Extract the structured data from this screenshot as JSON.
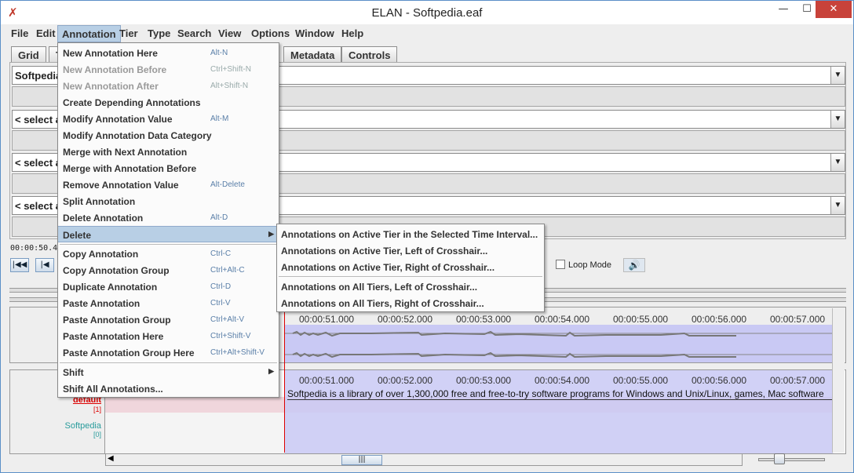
{
  "window": {
    "title": "ELAN - Softpedia.eaf",
    "minimize": "—",
    "maximize": "☐",
    "close": "✕"
  },
  "menubar": [
    "File",
    "Edit",
    "Annotation",
    "Tier",
    "Type",
    "Search",
    "View",
    "Options",
    "Window",
    "Help"
  ],
  "tabs": {
    "grid": "Grid",
    "t": "T",
    "metadata": "Metadata",
    "controls": "Controls"
  },
  "panel": {
    "combo1": "Softpedia",
    "combo2": "< select a",
    "combo3": "< select a",
    "combo4": "< select a"
  },
  "timecode": "00:00:50.461",
  "loop_mode": "Loop Mode",
  "ruler": [
    "00:00:51.000",
    "00:00:52.000",
    "00:00:53.000",
    "00:00:54.000",
    "00:00:55.000",
    "00:00:56.000",
    "00:00:57.000"
  ],
  "tiers": {
    "default": {
      "name": "default",
      "count": "[1]"
    },
    "softpedia": {
      "name": "Softpedia",
      "count": "[0]"
    }
  },
  "annotation_text": "Softpedia is a library of over 1,300,000 free and free-to-try software programs for Windows and Unix/Linux, games, Mac software",
  "annotation_menu": [
    {
      "label": "New Annotation Here",
      "acc": "Alt-N",
      "disabled": false
    },
    {
      "label": "New Annotation Before",
      "acc": "Ctrl+Shift-N",
      "disabled": true
    },
    {
      "label": "New Annotation After",
      "acc": "Alt+Shift-N",
      "disabled": true
    },
    {
      "label": "Create Depending Annotations",
      "acc": "",
      "disabled": false
    },
    {
      "label": "Modify Annotation Value",
      "acc": "Alt-M",
      "disabled": false
    },
    {
      "label": "Modify Annotation Data Category",
      "acc": "",
      "disabled": false
    },
    {
      "label": "Merge with Next Annotation",
      "acc": "",
      "disabled": false
    },
    {
      "label": "Merge with Annotation Before",
      "acc": "",
      "disabled": false
    },
    {
      "label": "Remove Annotation Value",
      "acc": "Alt-Delete",
      "disabled": false
    },
    {
      "label": "Split Annotation",
      "acc": "",
      "disabled": false
    },
    {
      "label": "Delete Annotation",
      "acc": "Alt-D",
      "disabled": false
    },
    {
      "label": "Delete",
      "acc": "",
      "disabled": false
    },
    {
      "label": "Copy Annotation",
      "acc": "Ctrl-C",
      "disabled": false
    },
    {
      "label": "Copy Annotation Group",
      "acc": "Ctrl+Alt-C",
      "disabled": false
    },
    {
      "label": "Duplicate Annotation",
      "acc": "Ctrl-D",
      "disabled": false
    },
    {
      "label": "Paste Annotation",
      "acc": "Ctrl-V",
      "disabled": false
    },
    {
      "label": "Paste Annotation Group",
      "acc": "Ctrl+Alt-V",
      "disabled": false
    },
    {
      "label": "Paste Annotation Here",
      "acc": "Ctrl+Shift-V",
      "disabled": false
    },
    {
      "label": "Paste Annotation Group Here",
      "acc": "Ctrl+Alt+Shift-V",
      "disabled": false
    },
    {
      "label": "Shift",
      "acc": "",
      "disabled": false
    },
    {
      "label": "Shift All Annotations...",
      "acc": "",
      "disabled": false
    }
  ],
  "delete_submenu": [
    "Annotations on Active Tier in the Selected Time Interval...",
    "Annotations on Active Tier, Left of Crosshair...",
    "Annotations on Active Tier, Right of Crosshair...",
    "Annotations on All Tiers, Left of Crosshair...",
    "Annotations on All Tiers, Right of Crosshair..."
  ]
}
